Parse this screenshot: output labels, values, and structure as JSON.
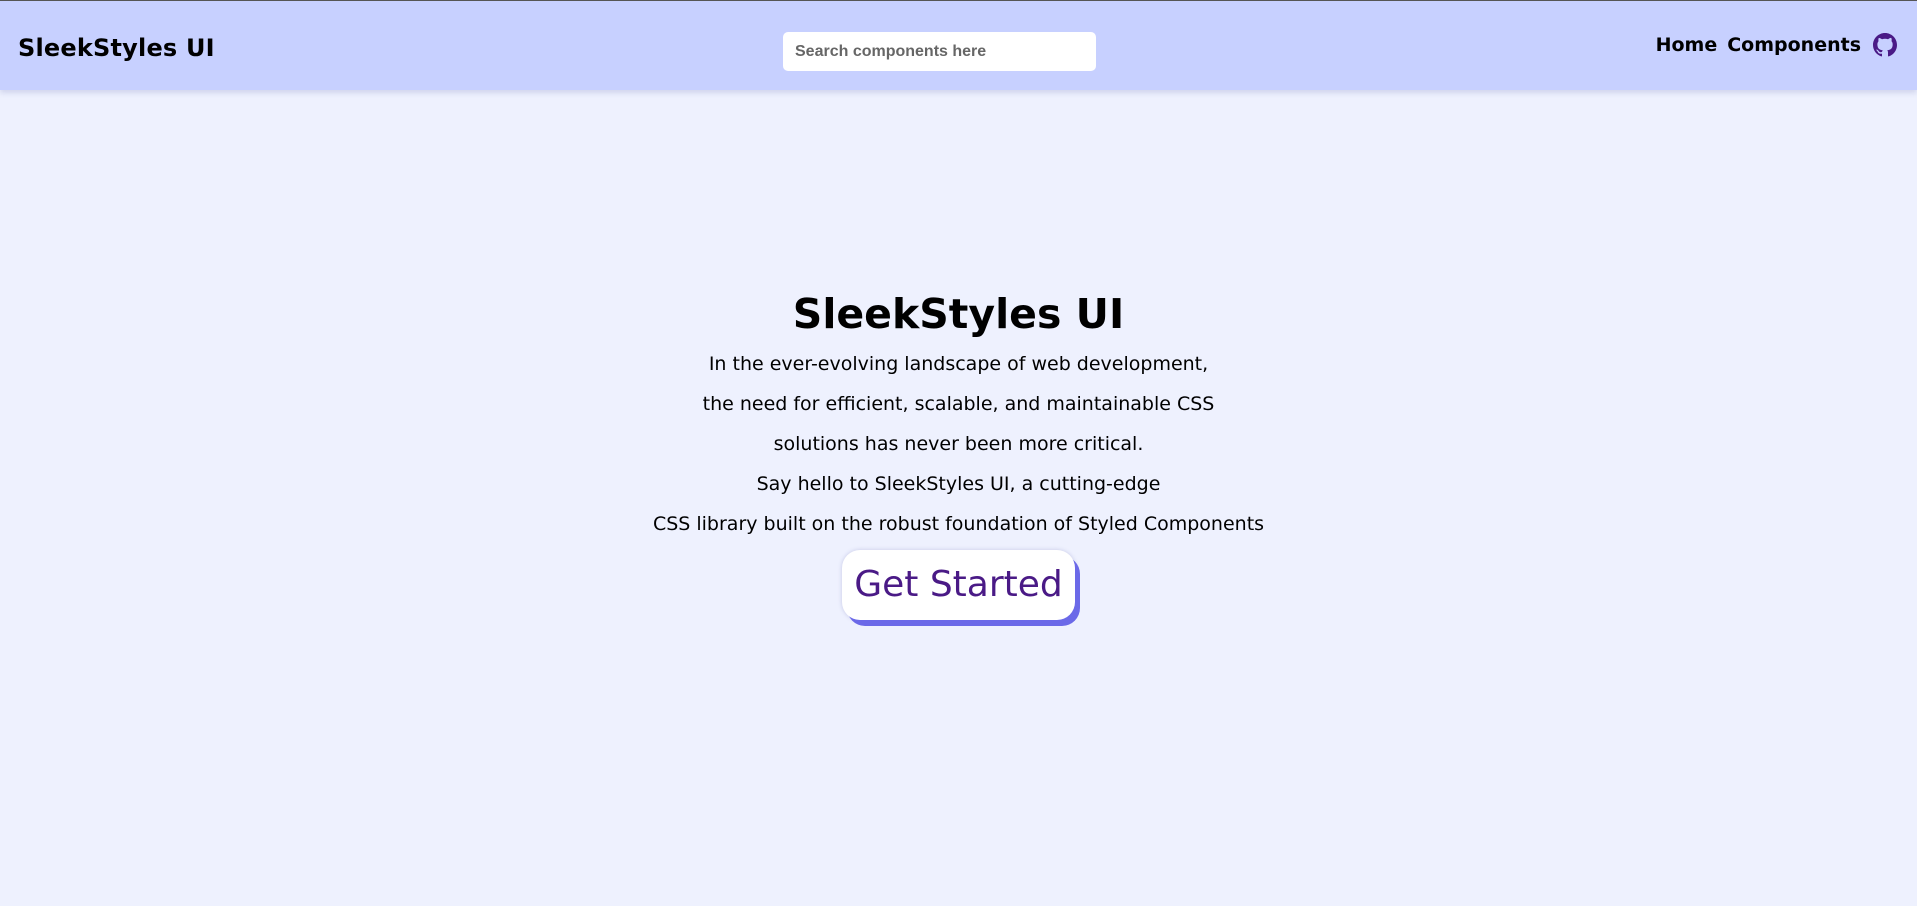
{
  "navbar": {
    "brand": "SleekStyles UI",
    "search_placeholder": "Search components here",
    "links": [
      "Home",
      "Components"
    ],
    "github_icon": "github-icon"
  },
  "hero": {
    "title": "SleekStyles UI",
    "lines": [
      "In the ever-evolving landscape of web development,",
      "the need for efficient, scalable, and maintainable CSS",
      "solutions has never been more critical.",
      "Say hello to SleekStyles UI, a cutting-edge",
      "CSS library built on the robust foundation of Styled Components"
    ],
    "cta_label": "Get Started"
  },
  "colors": {
    "navbar_bg": "#c7d0ff",
    "page_bg": "#eef1fe",
    "cta_text": "#4a1a86",
    "cta_shadow": "#6b69e8",
    "github_icon": "#4a1a86"
  }
}
